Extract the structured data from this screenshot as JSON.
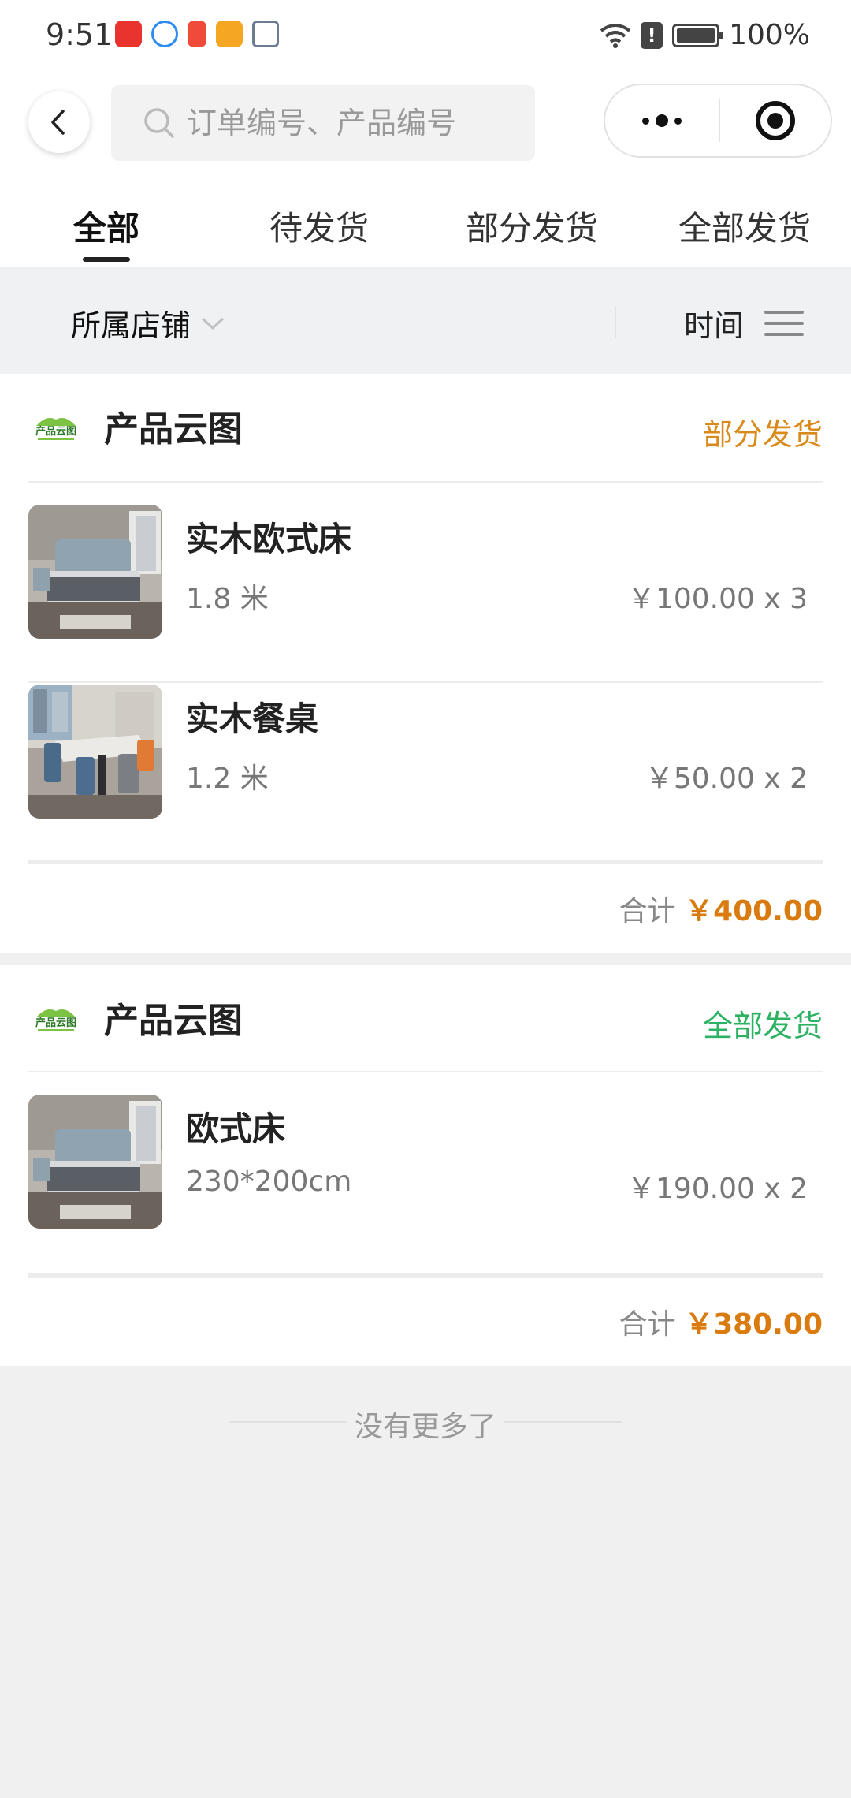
{
  "status_bar": {
    "time": "9:51",
    "battery": "100%"
  },
  "header": {
    "search_placeholder": "订单编号、产品编号"
  },
  "tabs": [
    {
      "label": "全部",
      "active": true
    },
    {
      "label": "待发货",
      "active": false
    },
    {
      "label": "部分发货",
      "active": false
    },
    {
      "label": "全部发货",
      "active": false
    }
  ],
  "filter": {
    "shop_label": "所属店铺",
    "time_label": "时间"
  },
  "orders": [
    {
      "shop_name": "产品云图",
      "status": "部分发货",
      "status_color": "#d98a1a",
      "items": [
        {
          "name": "实木欧式床",
          "spec": "1.8 米",
          "price": "￥100.00 x 3"
        },
        {
          "name": "实木餐桌",
          "spec": "1.2 米",
          "price": "￥50.00 x 2"
        }
      ],
      "total_label": "合计",
      "total_value": "￥400.00"
    },
    {
      "shop_name": "产品云图",
      "status": "全部发货",
      "status_color": "#2db264",
      "items": [
        {
          "name": "欧式床",
          "spec": "230*200cm",
          "price": "￥190.00 x 2"
        }
      ],
      "total_label": "合计",
      "total_value": "￥380.00"
    }
  ],
  "footer": {
    "no_more": "没有更多了"
  }
}
